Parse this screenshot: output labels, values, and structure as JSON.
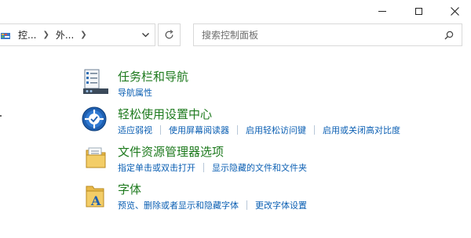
{
  "window": {
    "controls": [
      "minimize",
      "maximize",
      "close"
    ]
  },
  "address_bar": {
    "crumbs": [
      "控...",
      "外..."
    ],
    "dropdown_icon": "chevron-down-icon",
    "refresh_icon": "refresh-icon"
  },
  "search": {
    "placeholder": "搜索控制面板",
    "icon": "search-icon"
  },
  "categories": [
    {
      "title": "任务栏和导航",
      "icon": "taskbar-icon",
      "links": [
        "导航属性"
      ]
    },
    {
      "title": "轻松使用设置中心",
      "icon": "ease-of-access-icon",
      "links": [
        "适应弱视",
        "使用屏幕阅读器",
        "启用轻松访问键",
        "启用或关闭高对比度"
      ]
    },
    {
      "title": "文件资源管理器选项",
      "icon": "folder-options-icon",
      "links": [
        "指定单击或双击打开",
        "显示隐藏的文件和文件夹"
      ]
    },
    {
      "title": "字体",
      "icon": "fonts-icon",
      "links": [
        "预览、删除或者显示和隐藏字体",
        "更改字体设置"
      ]
    }
  ],
  "colors": {
    "title_green": "#1e7a1e",
    "link_blue": "#0b5fb3"
  }
}
